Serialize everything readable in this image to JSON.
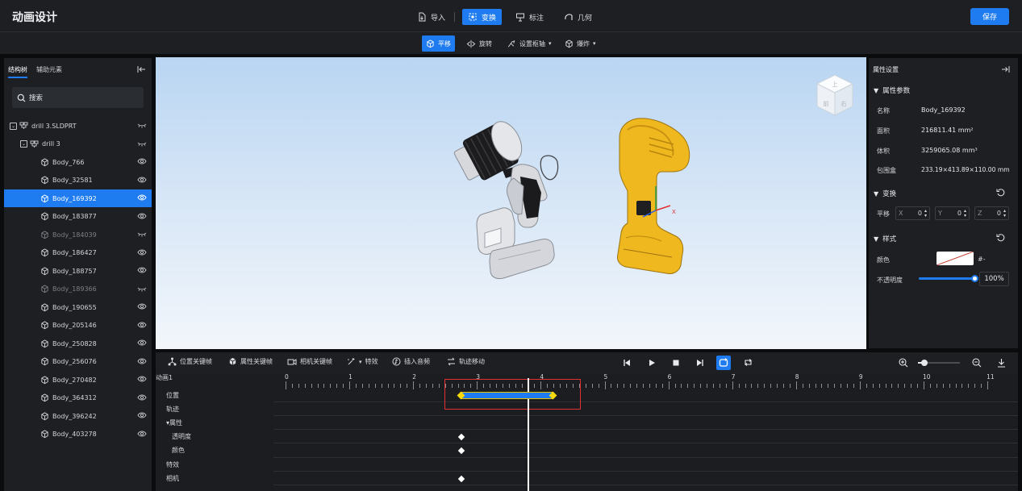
{
  "app": {
    "title": "动画设计"
  },
  "toolbar": {
    "import_label": "导入",
    "transform_label": "变换",
    "annotate_label": "标注",
    "geometry_label": "几何",
    "save_label": "保存",
    "accent": "#1f7cf0"
  },
  "subtoolbar": {
    "translate_label": "平移",
    "rotate_label": "旋转",
    "pivot_label": "设置枢轴",
    "explode_label": "爆炸"
  },
  "left_panel": {
    "tabs": [
      "结构树",
      "辅助元素"
    ],
    "search_placeholder": "搜索",
    "tree": [
      {
        "label": "drill 3.SLDPRT",
        "level": 0,
        "kind": "assembly",
        "state": "hidden"
      },
      {
        "label": "drill 3",
        "level": 1,
        "kind": "assembly",
        "state": "hidden"
      },
      {
        "label": "Body_766",
        "level": 2,
        "kind": "body",
        "state": "visible"
      },
      {
        "label": "Body_32581",
        "level": 2,
        "kind": "body",
        "state": "visible"
      },
      {
        "label": "Body_169392",
        "level": 2,
        "kind": "body",
        "state": "selected"
      },
      {
        "label": "Body_183877",
        "level": 2,
        "kind": "body",
        "state": "visible"
      },
      {
        "label": "Body_184039",
        "level": 2,
        "kind": "body",
        "state": "hidden"
      },
      {
        "label": "Body_186427",
        "level": 2,
        "kind": "body",
        "state": "visible"
      },
      {
        "label": "Body_188757",
        "level": 2,
        "kind": "body",
        "state": "visible"
      },
      {
        "label": "Body_189366",
        "level": 2,
        "kind": "body",
        "state": "hidden"
      },
      {
        "label": "Body_190655",
        "level": 2,
        "kind": "body",
        "state": "visible"
      },
      {
        "label": "Body_205146",
        "level": 2,
        "kind": "body",
        "state": "visible"
      },
      {
        "label": "Body_250828",
        "level": 2,
        "kind": "body",
        "state": "visible"
      },
      {
        "label": "Body_256076",
        "level": 2,
        "kind": "body",
        "state": "visible"
      },
      {
        "label": "Body_270482",
        "level": 2,
        "kind": "body",
        "state": "visible"
      },
      {
        "label": "Body_364312",
        "level": 2,
        "kind": "body",
        "state": "visible"
      },
      {
        "label": "Body_396242",
        "level": 2,
        "kind": "body",
        "state": "visible"
      },
      {
        "label": "Body_403278",
        "level": 2,
        "kind": "body",
        "state": "visible"
      }
    ]
  },
  "viewport": {
    "view_cube": {
      "top": "上",
      "front": "前",
      "right": "右"
    },
    "axis_x": "X"
  },
  "properties": {
    "title": "属性设置",
    "section_params": "属性参数",
    "name_label": "名称",
    "name_value": "Body_169392",
    "area_label": "面积",
    "area_value": "216811.41 mm²",
    "volume_label": "体积",
    "volume_value": "3259065.08 mm³",
    "bbox_label": "包围盒",
    "bbox_value": "233.19×413.89×110.00 mm",
    "section_transform": "变换",
    "translate_label": "平移",
    "x_label": "X",
    "x_value": "0",
    "y_label": "Y",
    "y_value": "0",
    "z_label": "Z",
    "z_value": "0",
    "section_style": "样式",
    "color_label": "颜色",
    "color_value": "#-",
    "opacity_label": "不透明度",
    "opacity_value": "100%",
    "opacity_fraction": 1.0
  },
  "timeline": {
    "toolbar": {
      "position_keyframe": "位置关键帧",
      "property_keyframe": "属性关键帧",
      "camera_keyframe": "相机关键帧",
      "effects": "特效",
      "insert_audio": "插入音频",
      "track_move": "轨迹移动"
    },
    "animation_name": "动画1",
    "ruler": [
      "0",
      "1",
      "2",
      "3",
      "4",
      "5",
      "6",
      "7",
      "8",
      "9",
      "10",
      "11"
    ],
    "tracks": [
      {
        "label": "位置",
        "indent": 0
      },
      {
        "label": "轨迹",
        "indent": 0
      },
      {
        "label": "▾属性",
        "indent": 0
      },
      {
        "label": "透明度",
        "indent": 1
      },
      {
        "label": "颜色",
        "indent": 1
      },
      {
        "label": "特效",
        "indent": 0
      },
      {
        "label": "相机",
        "indent": 0
      }
    ],
    "playhead_time": 3.8,
    "position_clip": {
      "start": 2.75,
      "end": 4.2
    },
    "keyframes": [
      {
        "track": 3,
        "time": 2.75
      },
      {
        "track": 4,
        "time": 2.75
      },
      {
        "track": 6,
        "time": 2.75
      }
    ]
  }
}
